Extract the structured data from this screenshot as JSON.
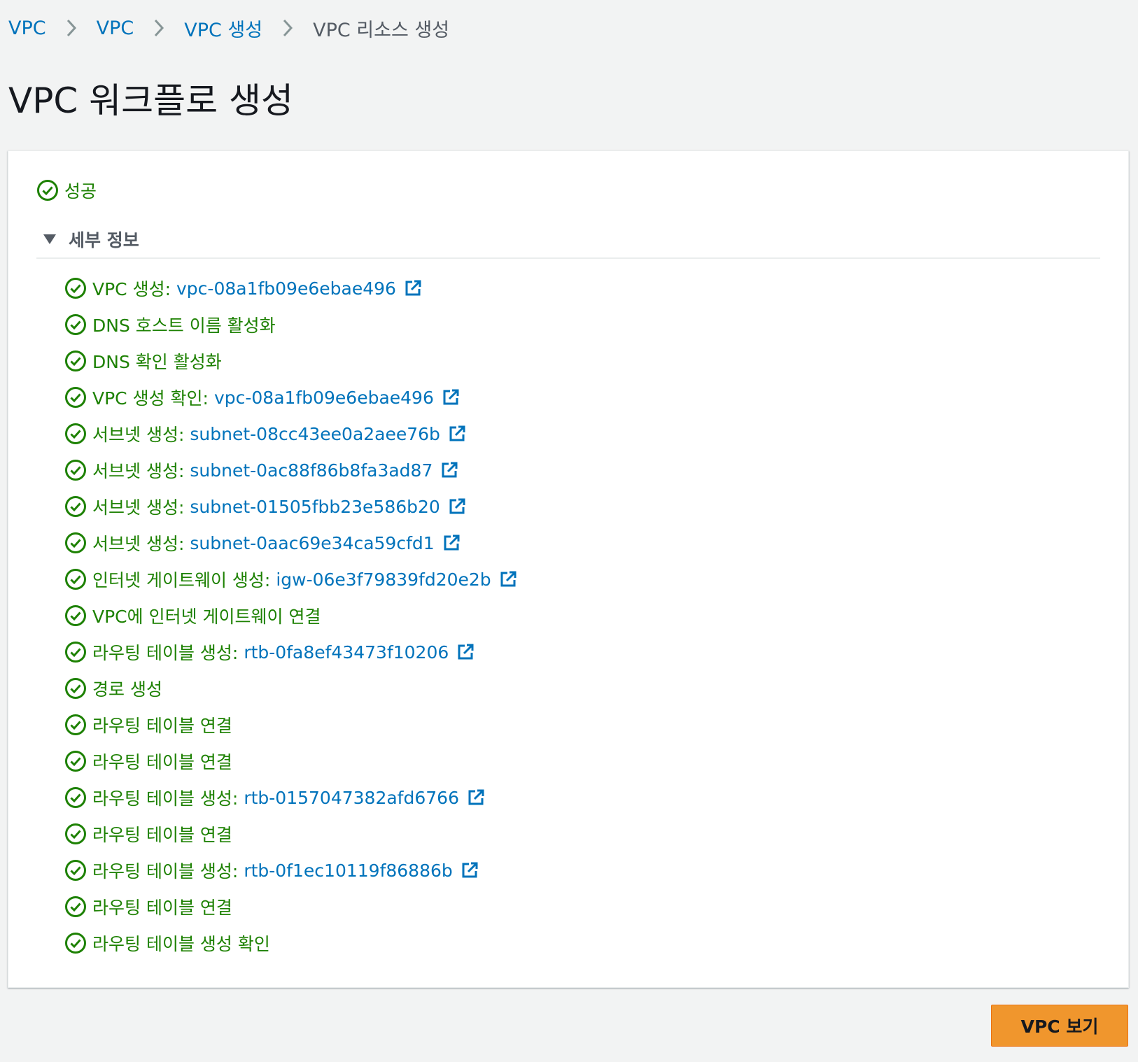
{
  "breadcrumb": {
    "items": [
      "VPC",
      "VPC",
      "VPC 생성"
    ],
    "current": "VPC 리소스 생성"
  },
  "page": {
    "title": "VPC 워크플로 생성"
  },
  "status": {
    "label": "성공"
  },
  "details": {
    "label": "세부 정보",
    "steps": [
      {
        "label": "VPC 생성:",
        "link": "vpc-08a1fb09e6ebae496"
      },
      {
        "label": "DNS 호스트 이름 활성화",
        "link": ""
      },
      {
        "label": "DNS 확인 활성화",
        "link": ""
      },
      {
        "label": "VPC 생성 확인:",
        "link": "vpc-08a1fb09e6ebae496"
      },
      {
        "label": "서브넷 생성:",
        "link": "subnet-08cc43ee0a2aee76b"
      },
      {
        "label": "서브넷 생성:",
        "link": "subnet-0ac88f86b8fa3ad87"
      },
      {
        "label": "서브넷 생성:",
        "link": "subnet-01505fbb23e586b20"
      },
      {
        "label": "서브넷 생성:",
        "link": "subnet-0aac69e34ca59cfd1"
      },
      {
        "label": "인터넷 게이트웨이 생성:",
        "link": "igw-06e3f79839fd20e2b"
      },
      {
        "label": "VPC에 인터넷 게이트웨이 연결",
        "link": ""
      },
      {
        "label": "라우팅 테이블 생성:",
        "link": "rtb-0fa8ef43473f10206"
      },
      {
        "label": "경로 생성",
        "link": ""
      },
      {
        "label": "라우팅 테이블 연결",
        "link": ""
      },
      {
        "label": "라우팅 테이블 연결",
        "link": ""
      },
      {
        "label": "라우팅 테이블 생성:",
        "link": "rtb-0157047382afd6766"
      },
      {
        "label": "라우팅 테이블 연결",
        "link": ""
      },
      {
        "label": "라우팅 테이블 생성:",
        "link": "rtb-0f1ec10119f86886b"
      },
      {
        "label": "라우팅 테이블 연결",
        "link": ""
      },
      {
        "label": "라우팅 테이블 생성 확인",
        "link": ""
      }
    ]
  },
  "actions": {
    "view_vpc_label": "VPC 보기"
  },
  "colors": {
    "success": "#1d8102",
    "link": "#0073bb",
    "primary_button": "#f0962d",
    "background": "#f2f3f3"
  },
  "icons": {
    "separator": "chevron-right-icon",
    "status": "check-circle-icon",
    "toggle": "caret-down-icon",
    "external": "external-link-icon"
  }
}
